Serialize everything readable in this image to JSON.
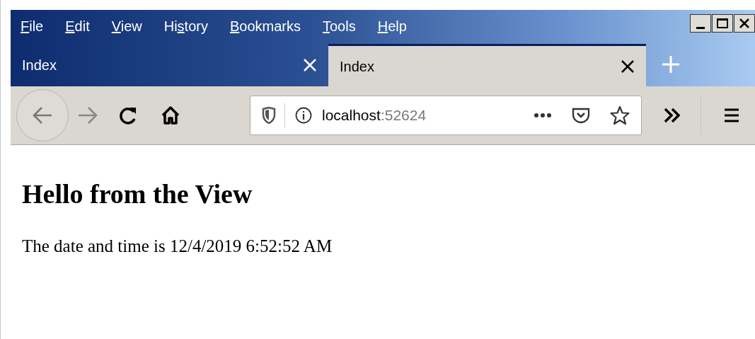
{
  "menu": [
    {
      "key": "F",
      "post": "ile"
    },
    {
      "key": "E",
      "post": "dit"
    },
    {
      "key": "V",
      "post": "iew"
    },
    {
      "pre": "Hi",
      "key": "s",
      "post": "tory"
    },
    {
      "key": "B",
      "post": "ookmarks"
    },
    {
      "key": "T",
      "post": "ools"
    },
    {
      "key": "H",
      "post": "elp"
    }
  ],
  "tabs": [
    {
      "title": "Index",
      "selected": false
    },
    {
      "title": "Index",
      "selected": true
    }
  ],
  "address": {
    "host": "localhost",
    "port": ":52624"
  },
  "page": {
    "heading": "Hello from the View",
    "text": "The date and time is 12/4/2019 6:52:52 AM"
  }
}
